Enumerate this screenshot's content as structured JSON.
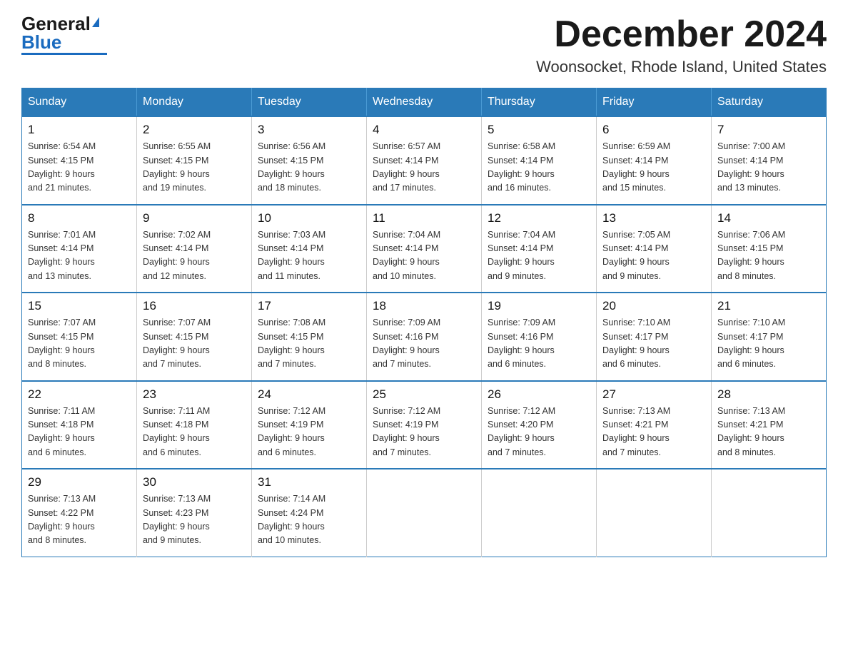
{
  "logo": {
    "general": "General",
    "triangle": "▶",
    "blue": "Blue"
  },
  "title": {
    "month": "December 2024",
    "location": "Woonsocket, Rhode Island, United States"
  },
  "headers": [
    "Sunday",
    "Monday",
    "Tuesday",
    "Wednesday",
    "Thursday",
    "Friday",
    "Saturday"
  ],
  "weeks": [
    [
      {
        "day": "1",
        "sunrise": "6:54 AM",
        "sunset": "4:15 PM",
        "daylight": "9 hours and 21 minutes."
      },
      {
        "day": "2",
        "sunrise": "6:55 AM",
        "sunset": "4:15 PM",
        "daylight": "9 hours and 19 minutes."
      },
      {
        "day": "3",
        "sunrise": "6:56 AM",
        "sunset": "4:15 PM",
        "daylight": "9 hours and 18 minutes."
      },
      {
        "day": "4",
        "sunrise": "6:57 AM",
        "sunset": "4:14 PM",
        "daylight": "9 hours and 17 minutes."
      },
      {
        "day": "5",
        "sunrise": "6:58 AM",
        "sunset": "4:14 PM",
        "daylight": "9 hours and 16 minutes."
      },
      {
        "day": "6",
        "sunrise": "6:59 AM",
        "sunset": "4:14 PM",
        "daylight": "9 hours and 15 minutes."
      },
      {
        "day": "7",
        "sunrise": "7:00 AM",
        "sunset": "4:14 PM",
        "daylight": "9 hours and 13 minutes."
      }
    ],
    [
      {
        "day": "8",
        "sunrise": "7:01 AM",
        "sunset": "4:14 PM",
        "daylight": "9 hours and 13 minutes."
      },
      {
        "day": "9",
        "sunrise": "7:02 AM",
        "sunset": "4:14 PM",
        "daylight": "9 hours and 12 minutes."
      },
      {
        "day": "10",
        "sunrise": "7:03 AM",
        "sunset": "4:14 PM",
        "daylight": "9 hours and 11 minutes."
      },
      {
        "day": "11",
        "sunrise": "7:04 AM",
        "sunset": "4:14 PM",
        "daylight": "9 hours and 10 minutes."
      },
      {
        "day": "12",
        "sunrise": "7:04 AM",
        "sunset": "4:14 PM",
        "daylight": "9 hours and 9 minutes."
      },
      {
        "day": "13",
        "sunrise": "7:05 AM",
        "sunset": "4:14 PM",
        "daylight": "9 hours and 9 minutes."
      },
      {
        "day": "14",
        "sunrise": "7:06 AM",
        "sunset": "4:15 PM",
        "daylight": "9 hours and 8 minutes."
      }
    ],
    [
      {
        "day": "15",
        "sunrise": "7:07 AM",
        "sunset": "4:15 PM",
        "daylight": "9 hours and 8 minutes."
      },
      {
        "day": "16",
        "sunrise": "7:07 AM",
        "sunset": "4:15 PM",
        "daylight": "9 hours and 7 minutes."
      },
      {
        "day": "17",
        "sunrise": "7:08 AM",
        "sunset": "4:15 PM",
        "daylight": "9 hours and 7 minutes."
      },
      {
        "day": "18",
        "sunrise": "7:09 AM",
        "sunset": "4:16 PM",
        "daylight": "9 hours and 7 minutes."
      },
      {
        "day": "19",
        "sunrise": "7:09 AM",
        "sunset": "4:16 PM",
        "daylight": "9 hours and 6 minutes."
      },
      {
        "day": "20",
        "sunrise": "7:10 AM",
        "sunset": "4:17 PM",
        "daylight": "9 hours and 6 minutes."
      },
      {
        "day": "21",
        "sunrise": "7:10 AM",
        "sunset": "4:17 PM",
        "daylight": "9 hours and 6 minutes."
      }
    ],
    [
      {
        "day": "22",
        "sunrise": "7:11 AM",
        "sunset": "4:18 PM",
        "daylight": "9 hours and 6 minutes."
      },
      {
        "day": "23",
        "sunrise": "7:11 AM",
        "sunset": "4:18 PM",
        "daylight": "9 hours and 6 minutes."
      },
      {
        "day": "24",
        "sunrise": "7:12 AM",
        "sunset": "4:19 PM",
        "daylight": "9 hours and 6 minutes."
      },
      {
        "day": "25",
        "sunrise": "7:12 AM",
        "sunset": "4:19 PM",
        "daylight": "9 hours and 7 minutes."
      },
      {
        "day": "26",
        "sunrise": "7:12 AM",
        "sunset": "4:20 PM",
        "daylight": "9 hours and 7 minutes."
      },
      {
        "day": "27",
        "sunrise": "7:13 AM",
        "sunset": "4:21 PM",
        "daylight": "9 hours and 7 minutes."
      },
      {
        "day": "28",
        "sunrise": "7:13 AM",
        "sunset": "4:21 PM",
        "daylight": "9 hours and 8 minutes."
      }
    ],
    [
      {
        "day": "29",
        "sunrise": "7:13 AM",
        "sunset": "4:22 PM",
        "daylight": "9 hours and 8 minutes."
      },
      {
        "day": "30",
        "sunrise": "7:13 AM",
        "sunset": "4:23 PM",
        "daylight": "9 hours and 9 minutes."
      },
      {
        "day": "31",
        "sunrise": "7:14 AM",
        "sunset": "4:24 PM",
        "daylight": "9 hours and 10 minutes."
      },
      null,
      null,
      null,
      null
    ]
  ],
  "labels": {
    "sunrise": "Sunrise:",
    "sunset": "Sunset:",
    "daylight": "Daylight:"
  }
}
